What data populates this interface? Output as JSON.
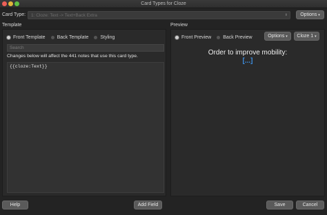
{
  "window": {
    "title": "Card Types for Cloze"
  },
  "card_type": {
    "label": "Card Type:",
    "selected": "1: Cloze: Text -> Text+Back Extra",
    "options_button": "Options",
    "options_arrow": "▾"
  },
  "template": {
    "section_label": "Template",
    "tabs": [
      {
        "label": "Front Template",
        "selected": true
      },
      {
        "label": "Back Template",
        "selected": false
      },
      {
        "label": "Styling",
        "selected": false
      }
    ],
    "search_placeholder": "Search",
    "changes_note": "Changes below will affect the 441 notes that use this card type.",
    "editor_text": "{{cloze:Text}}"
  },
  "preview": {
    "section_label": "Preview",
    "tabs": [
      {
        "label": "Front Preview",
        "selected": true
      },
      {
        "label": "Back Preview",
        "selected": false
      }
    ],
    "options_button": "Options",
    "options_arrow": "▾",
    "cloze_select": "Cloze 1",
    "cloze_arrow": "▾",
    "question_text": "Order to improve mobility:",
    "cloze_text": "[...]",
    "cloze_color": "#3d8ee0"
  },
  "footer": {
    "help": "Help",
    "add_field": "Add Field",
    "save": "Save",
    "cancel": "Cancel"
  }
}
